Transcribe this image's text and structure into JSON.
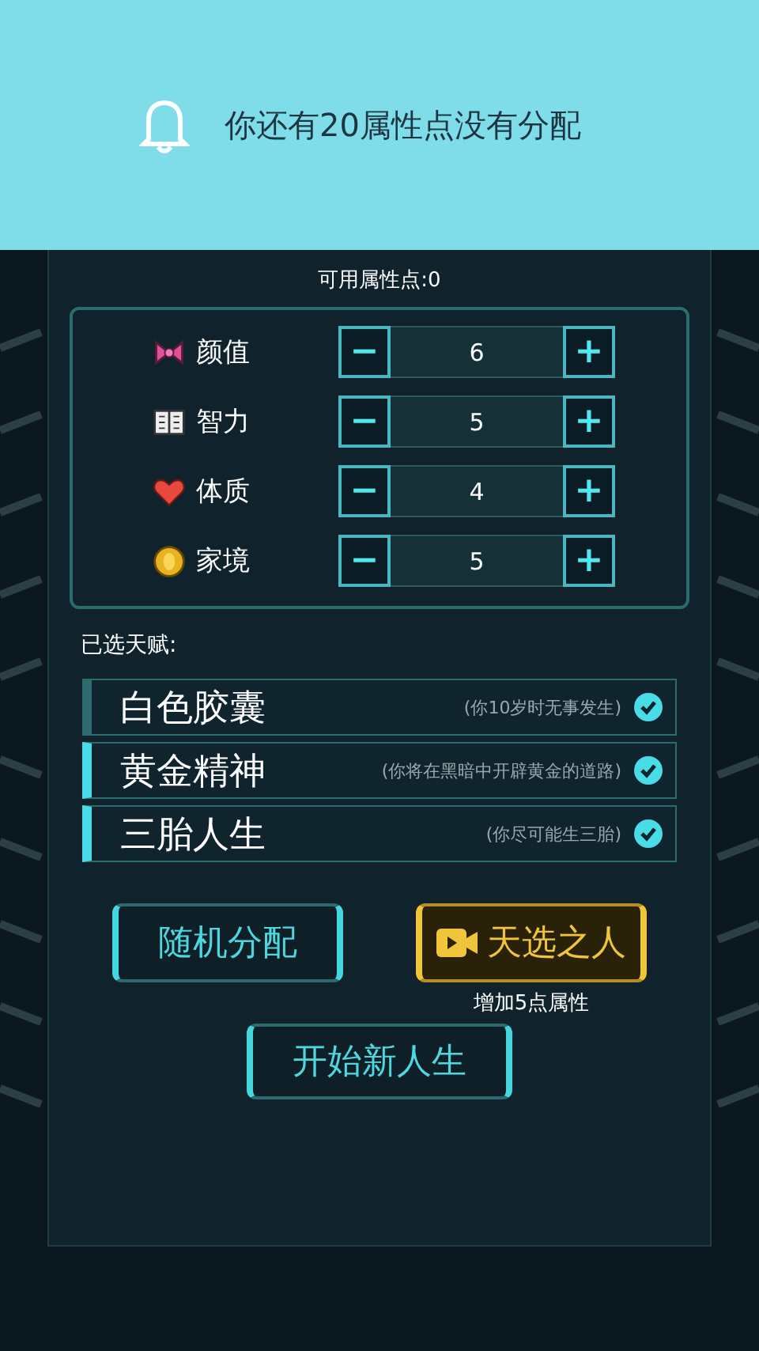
{
  "notification": {
    "message": "你还有20属性点没有分配"
  },
  "available_points": "可用属性点:0",
  "attributes": [
    {
      "kind": "bow",
      "name": "颜值",
      "minus": "−",
      "value": "6",
      "plus": "+"
    },
    {
      "kind": "book",
      "name": "智力",
      "minus": "−",
      "value": "5",
      "plus": "+"
    },
    {
      "kind": "heart",
      "name": "体质",
      "minus": "−",
      "value": "4",
      "plus": "+"
    },
    {
      "kind": "coin",
      "name": "家境",
      "minus": "−",
      "value": "5",
      "plus": "+"
    }
  ],
  "talents_heading": "已选天赋:",
  "talents": [
    {
      "name": "白色胶囊",
      "description": "(你10岁时无事发生)",
      "accent": false,
      "checked": true
    },
    {
      "name": "黄金精神",
      "description": "(你将在黑暗中开辟黄金的道路)",
      "accent": true,
      "checked": true
    },
    {
      "name": "三胎人生",
      "description": "(你尽可能生三胎)",
      "accent": true,
      "checked": true
    }
  ],
  "buttons": [
    {
      "kind": "plain",
      "label": "随机分配"
    },
    {
      "kind": "video",
      "label": "天选之人",
      "caption": "增加5点属性"
    }
  ],
  "start_button": "开始新人生"
}
